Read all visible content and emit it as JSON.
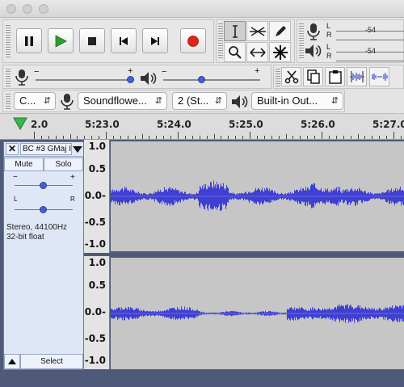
{
  "transport": {
    "pause_icon": "pause-icon",
    "play_icon": "play-icon",
    "stop_icon": "stop-icon",
    "skip_start_icon": "skip-to-start-icon",
    "skip_end_icon": "skip-to-end-icon",
    "record_icon": "record-icon",
    "play_color": "#2e9e2e",
    "record_color": "#e0221c"
  },
  "tools": [
    "selection-tool",
    "envelope-tool",
    "draw-tool",
    "zoom-tool",
    "time-shift-tool",
    "multi-tool"
  ],
  "meters": {
    "record": {
      "channels": [
        "L",
        "R"
      ],
      "value": "-54"
    },
    "play": {
      "channels": [
        "L",
        "R"
      ],
      "value": "-54"
    }
  },
  "mixer": {
    "record_min": "−",
    "record_max": "+",
    "play_min": "−",
    "play_max": "+",
    "record_volume": 0.98,
    "play_volume": 0.4
  },
  "edit_tools": [
    "cut",
    "copy",
    "paste",
    "trim-audio",
    "silence-audio"
  ],
  "device": {
    "host": "C...",
    "recording_device": "Soundflowe...",
    "channels": "2 (St...",
    "playback_device": "Built-in Out..."
  },
  "timeline": {
    "ticks": [
      "2.0",
      "5:23.0",
      "5:24.0",
      "5:25.0",
      "5:26.0",
      "5:27.0"
    ]
  },
  "track": {
    "name": "BC #3 GMaj I",
    "mute_label": "Mute",
    "solo_label": "Solo",
    "gain_min": "−",
    "gain_max": "+",
    "pan_left": "L",
    "pan_right": "R",
    "gain": 0.5,
    "pan": 0.5,
    "format_line1": "Stereo, 44100Hz",
    "format_line2": "32-bit float",
    "select_label": "Select",
    "waveform_color": "#3f3fd4"
  },
  "vertical_ruler": [
    "1.0",
    "0.5",
    "0.0-",
    "-0.5",
    "-1.0"
  ]
}
